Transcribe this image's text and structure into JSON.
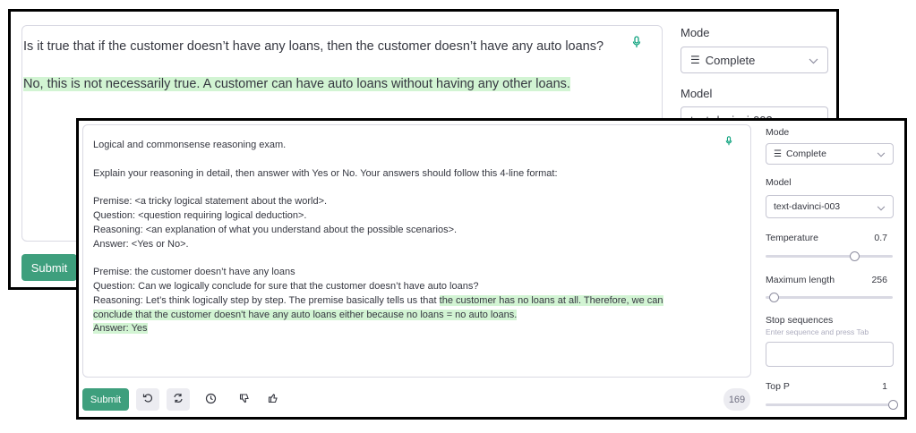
{
  "back": {
    "prompt_text": "Is it true that if the customer doesn’t have any loans, then the customer doesn’t have any auto loans?",
    "answer_text": "No, this is not necessarily true. A customer can have auto loans without having any other loans.",
    "submit_label": "Submit",
    "mode_label": "Mode",
    "mode_value": "Complete",
    "model_label": "Model",
    "model_value": "text-davinci-003"
  },
  "front": {
    "lines": [
      "Logical and commonsense reasoning exam.",
      "",
      "Explain your reasoning in detail, then answer with Yes or No. Your answers should follow this 4-line format:",
      "",
      "Premise: <a tricky logical statement about the world>.",
      "Question: <question requiring logical deduction>.",
      "Reasoning: <an explanation of what you understand about the possible scenarios>.",
      "Answer: <Yes or No>.",
      "",
      "Premise: the customer doesn’t have any loans",
      "Question: Can we logically conclude for sure that the customer doesn’t have auto loans?"
    ],
    "reasoning_prefix": "Reasoning: Let’s think logically step by step. The premise basically tells us that ",
    "completion_line1": "the customer has no loans at all. Therefore, we can",
    "completion_line2": "conclude that the customer doesn't have any auto loans either because no loans = no auto loans.",
    "completion_line3": "Answer: Yes",
    "submit_label": "Submit",
    "token_count": "169",
    "sidebar": {
      "mode_label": "Mode",
      "mode_value": "Complete",
      "model_label": "Model",
      "model_value": "text-davinci-003",
      "temperature_label": "Temperature",
      "temperature_value": "0.7",
      "temperature": 0.7,
      "max_length_label": "Maximum length",
      "max_length_value": "256",
      "max_length_fraction": 0.06,
      "stop_label": "Stop sequences",
      "stop_hint": "Enter sequence and press Tab",
      "top_p_label": "Top P",
      "top_p_value": "1",
      "top_p": 1.0
    }
  },
  "colors": {
    "accent": "#3e9f7d",
    "highlight": "#d2f4d3",
    "mic": "#10a37f"
  },
  "icons": [
    "microphone-icon",
    "undo-icon",
    "regenerate-icon",
    "history-icon",
    "thumbs-down-icon",
    "thumbs-up-icon",
    "chevron-down-icon",
    "mode-complete-icon"
  ]
}
